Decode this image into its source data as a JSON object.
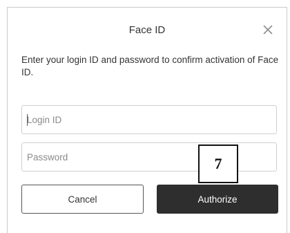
{
  "dialog": {
    "title": "Face ID",
    "close_icon": "close-icon",
    "description": "Enter your login ID and password to confirm activation of Face ID.",
    "login_field": {
      "placeholder": "Login ID",
      "value": ""
    },
    "password_field": {
      "placeholder": "Password",
      "value": ""
    },
    "cancel_label": "Cancel",
    "authorize_label": "Authorize"
  },
  "callout": {
    "number": "7"
  },
  "colors": {
    "authorize_bg": "#2e2e2e",
    "border": "#cfcfcf",
    "text": "#333333"
  }
}
